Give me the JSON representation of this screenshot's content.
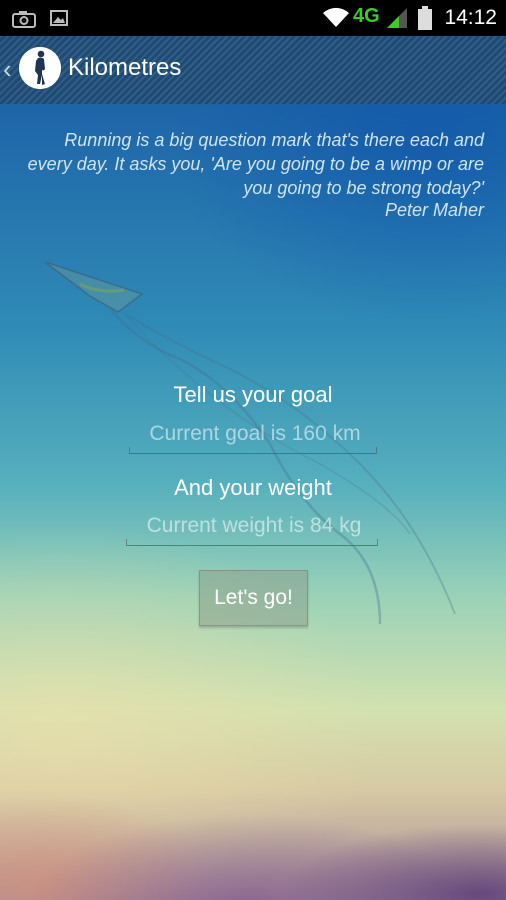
{
  "status_bar": {
    "time": "14:12",
    "network": "4G",
    "icons": [
      "camera-icon",
      "gallery-icon",
      "wifi-icon",
      "signal-icon",
      "battery-icon"
    ]
  },
  "action_bar": {
    "title": "Kilometres",
    "back_icon": "chevron-left-icon",
    "app_icon": "runner-icon",
    "background_color": "#1d4b76"
  },
  "quote": {
    "text": "Running is a big question mark that's there each and every day. It asks you, 'Are you going to be a wimp or are you going to be strong today?'",
    "author": "Peter Maher"
  },
  "goal": {
    "label": "Tell us your goal",
    "placeholder": "Current goal is 160 km"
  },
  "weight": {
    "label": "And your weight",
    "placeholder": "Current weight is 84 kg"
  },
  "submit": {
    "label": "Let's go!"
  }
}
